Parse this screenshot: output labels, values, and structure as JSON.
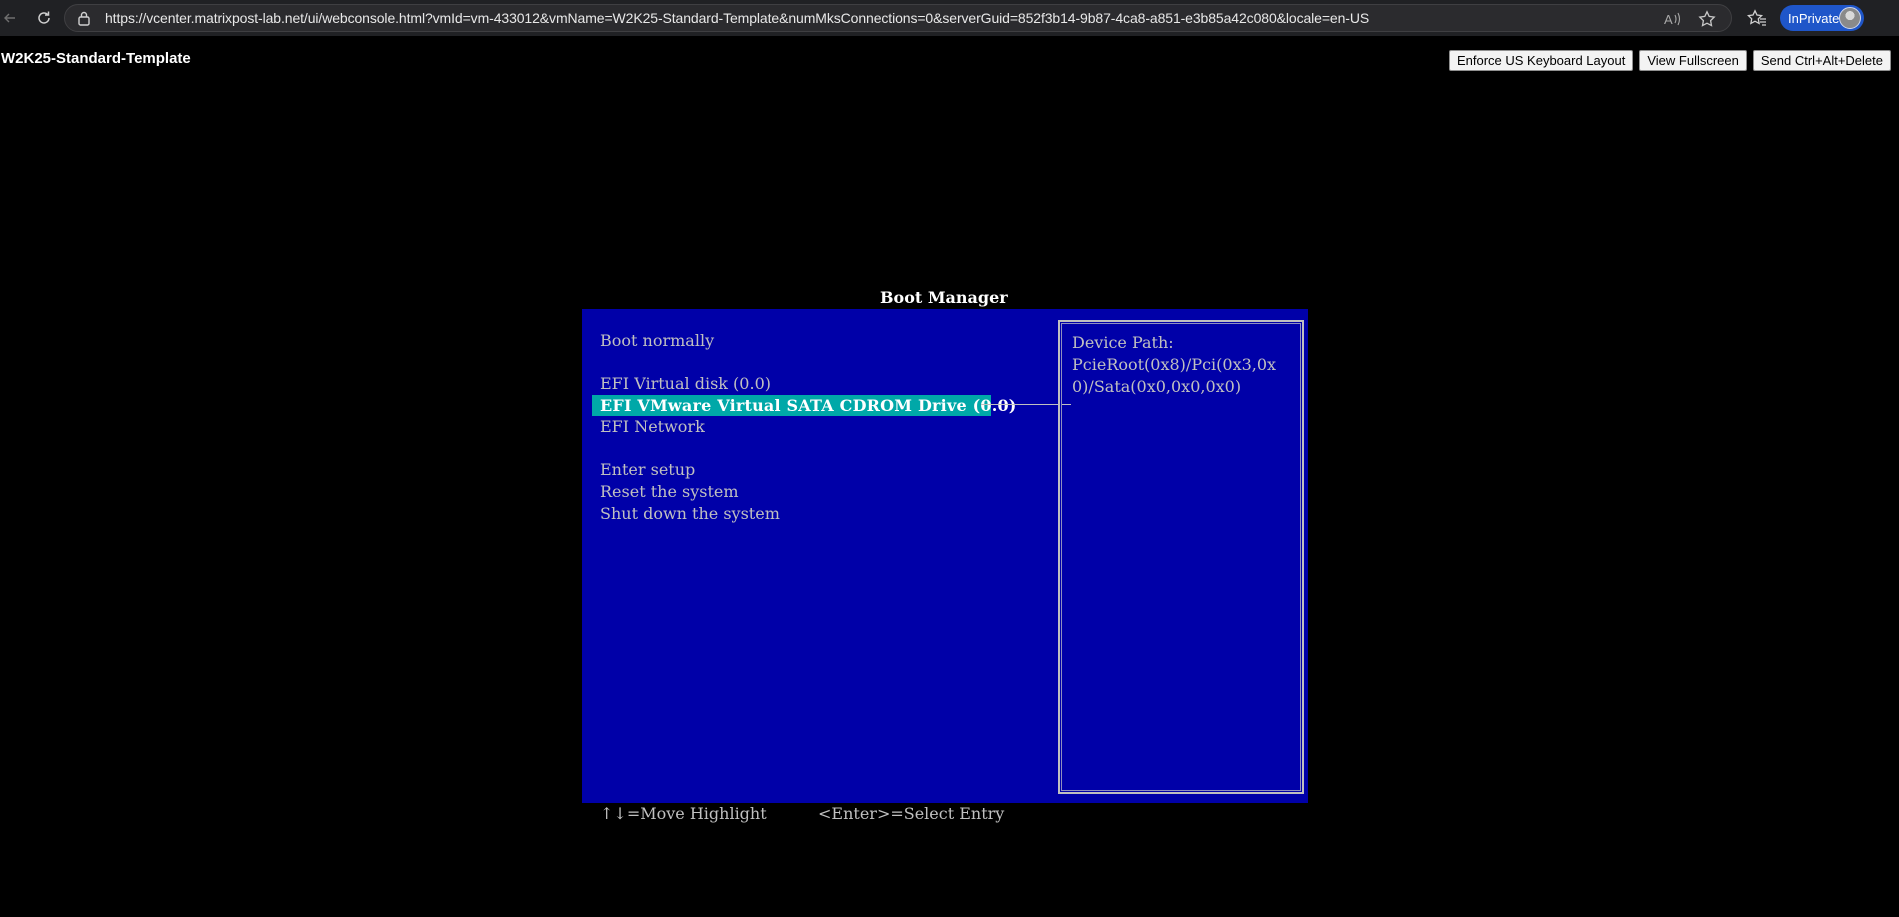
{
  "browser": {
    "url": "https://vcenter.matrixpost-lab.net/ui/webconsole.html?vmId=vm-433012&vmName=W2K25-Standard-Template&numMksConnections=0&serverGuid=852f3b14-9b87-4ca8-a851-e3b85a42c080&locale=en-US",
    "inprivate_label": "InPrivate",
    "icons": [
      "back-icon",
      "reload-icon",
      "lock-icon",
      "read-aloud-icon",
      "favorite-star-icon",
      "favorites-icon",
      "profile-avatar"
    ]
  },
  "console": {
    "vm_name": "W2K25-Standard-Template",
    "buttons": {
      "enforce_keyboard": "Enforce US Keyboard Layout",
      "fullscreen": "View Fullscreen",
      "ctrl_alt_del": "Send Ctrl+Alt+Delete"
    }
  },
  "boot_manager": {
    "title": "Boot Manager",
    "items": [
      "Boot normally",
      "EFI Virtual disk (0.0)",
      "EFI VMware Virtual SATA CDROM Drive (0.0)",
      "EFI Network",
      "Enter setup",
      "Reset the system",
      "Shut down the system"
    ],
    "selected_index": 2,
    "device_path_label": "Device Path:",
    "device_path_lines": [
      "PcieRoot(0x8)/Pci(0x3,0x",
      "0)/Sata(0x0,0x0,0x0)"
    ],
    "footer": {
      "move_hint": "↑↓=Move Highlight",
      "select_hint": "<Enter>=Select Entry"
    }
  },
  "colors": {
    "efi_background": "#0000a8",
    "efi_highlight": "#00a8a8",
    "efi_text": "#c0c0c0",
    "inprivate_badge": "#1f56c9"
  }
}
